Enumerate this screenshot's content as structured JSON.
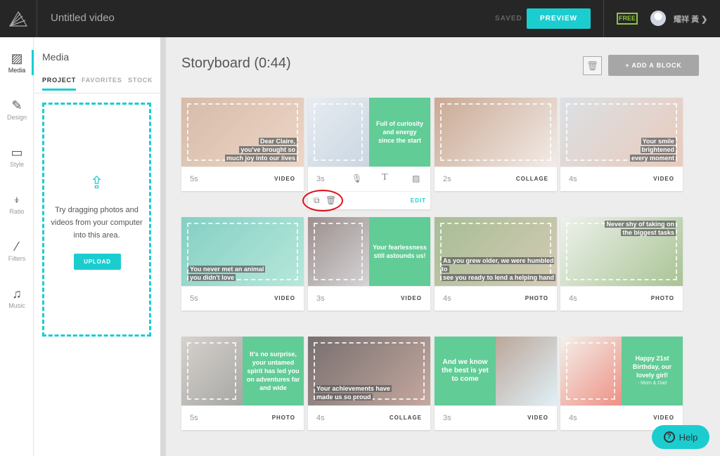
{
  "header": {
    "title": "Untitled video",
    "saved": "SAVED",
    "preview": "PREVIEW",
    "plan": "FREE",
    "user": "耀祥 黃 ❯"
  },
  "rail": [
    {
      "label": "Media",
      "icon": "image-icon"
    },
    {
      "label": "Design",
      "icon": "brush-icon"
    },
    {
      "label": "Style",
      "icon": "style-icon"
    },
    {
      "label": "Ratio",
      "icon": "ratio-icon"
    },
    {
      "label": "Filters",
      "icon": "magic-wand-icon"
    },
    {
      "label": "Music",
      "icon": "music-icon"
    }
  ],
  "panel": {
    "title": "Media",
    "tabs": [
      "PROJECT",
      "FAVORITES",
      "STOCK"
    ],
    "message": "Try dragging photos and videos from your computer into this area.",
    "upload": "UPLOAD"
  },
  "storyboard": {
    "title": "Storyboard (0:44)",
    "add_block": "+  ADD A BLOCK",
    "edit": "EDIT",
    "cards": [
      {
        "duration": "5s",
        "type": "VIDEO",
        "layout": "overlay",
        "caption": [
          "Dear Claire,",
          "you've brought so",
          "much joy into our lives"
        ],
        "photo": [
          "#c9a58c",
          "#e8c9b5"
        ]
      },
      {
        "duration": "3s",
        "type": "",
        "layout": "split-right",
        "caption": [
          "Full of curiosity",
          "and energy",
          "since the start"
        ],
        "photo": [
          "#dfe6ee",
          "#b9c9d8"
        ],
        "selected": true
      },
      {
        "duration": "2s",
        "type": "COLLAGE",
        "layout": "photo",
        "caption": [],
        "photo": [
          "#b88c70",
          "#efe6e0"
        ]
      },
      {
        "duration": "4s",
        "type": "VIDEO",
        "layout": "overlay",
        "caption": [
          "Your smile",
          "brightened",
          "every moment"
        ],
        "photo": [
          "#cfd6dc",
          "#e3b9a5"
        ]
      },
      {
        "duration": "5s",
        "type": "VIDEO",
        "layout": "overlay",
        "caption": [
          "You never met an animal",
          "you didn't love"
        ],
        "photo": [
          "#5cc0b0",
          "#9fe0cf"
        ]
      },
      {
        "duration": "3s",
        "type": "VIDEO",
        "layout": "split-right",
        "caption": [
          "Your fearlessness",
          "still astounds us!"
        ],
        "photo": [
          "#7b6a68",
          "#c9c6c8"
        ]
      },
      {
        "duration": "4s",
        "type": "PHOTO",
        "layout": "overlay",
        "caption": [
          "As you grew older, we were humbled to",
          "see you ready to lend a helping hand"
        ],
        "photo": [
          "#8aa874",
          "#c7b99a"
        ]
      },
      {
        "duration": "4s",
        "type": "PHOTO",
        "layout": "overlay",
        "caption": [
          "Never shy of taking on",
          "the biggest tasks"
        ],
        "photo": [
          "#e8eee6",
          "#8cb070"
        ]
      },
      {
        "duration": "5s",
        "type": "PHOTO",
        "layout": "split-right",
        "caption": [
          "It's no surprise,",
          "your untamed",
          "spirit has led you",
          "on adventures far",
          "and wide"
        ],
        "photo": [
          "#c9c3bd",
          "#8b8a86"
        ]
      },
      {
        "duration": "4s",
        "type": "COLLAGE",
        "layout": "overlay",
        "caption": [
          "Your achievements have",
          "made us so proud"
        ],
        "photo": [
          "#4a3f3f",
          "#b28c80"
        ]
      },
      {
        "duration": "3s",
        "type": "VIDEO",
        "layout": "split-left",
        "caption": [
          "And we know",
          "the best is yet",
          "to come"
        ],
        "photo": [
          "#a58a78",
          "#d7ecf5"
        ]
      },
      {
        "duration": "4s",
        "type": "VIDEO",
        "layout": "split-right",
        "caption": [
          "Happy 21st",
          "Birthday, our",
          "lovely girl!"
        ],
        "sub": "- Mom & Dad",
        "photo": [
          "#f0ece2",
          "#e86c5e"
        ]
      }
    ]
  },
  "help": "Help",
  "colors": {
    "accent": "#1ccdd0",
    "green": "#2dbb74",
    "topbar": "#262626",
    "free": "#8cc63f"
  }
}
